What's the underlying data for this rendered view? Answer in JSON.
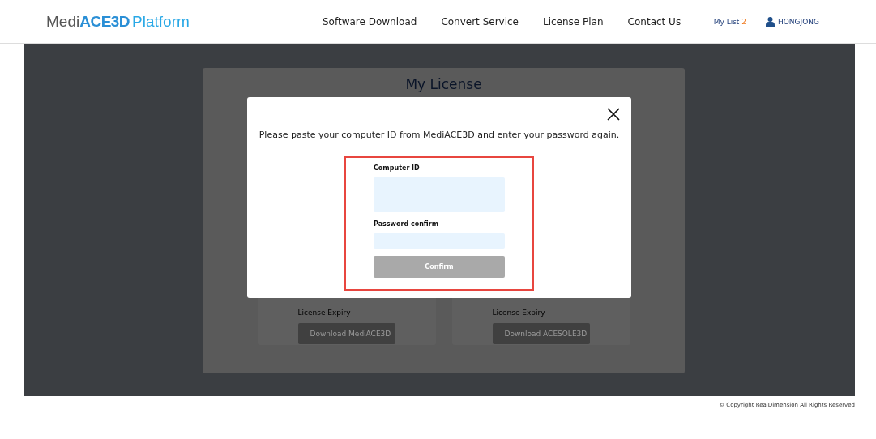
{
  "header": {
    "logo": {
      "part_1": "Medi",
      "part_2": "ACE3D",
      "part_3": "Platform"
    },
    "nav": [
      "Software Download",
      "Convert Service",
      "License Plan",
      "Contact Us"
    ],
    "my_list": {
      "label": "My List",
      "count": "2"
    },
    "user": "HONGJONG"
  },
  "page": {
    "title": "My License",
    "products": [
      {
        "label": "License Expiry",
        "value": "-",
        "button": "Download MediACE3D"
      },
      {
        "label": "License Expiry",
        "value": "-",
        "button": "Download ACESOLE3D"
      }
    ]
  },
  "modal": {
    "message": "Please paste your computer ID from MediACE3D and enter your password again.",
    "fields": [
      {
        "label": "Computer ID",
        "kind": "textarea"
      },
      {
        "label": "Password confirm",
        "kind": "password"
      }
    ],
    "confirm": {
      "label": "Confirm",
      "disabled": true
    }
  },
  "footer": "© Copyright RealDimension All Rights Reserved"
}
